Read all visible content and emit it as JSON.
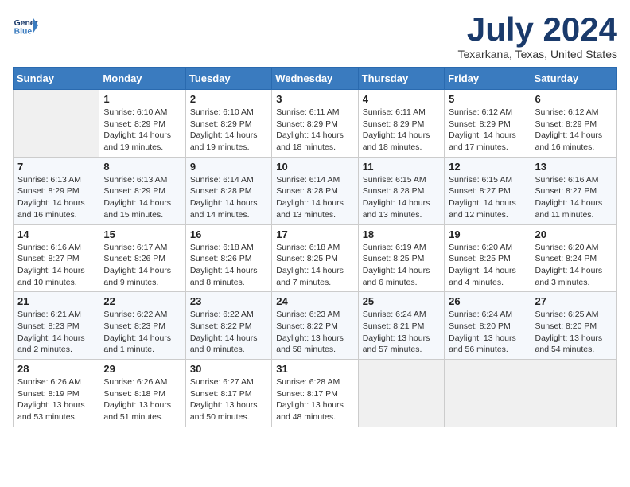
{
  "header": {
    "logo_line1": "General",
    "logo_line2": "Blue",
    "month": "July 2024",
    "location": "Texarkana, Texas, United States"
  },
  "weekdays": [
    "Sunday",
    "Monday",
    "Tuesday",
    "Wednesday",
    "Thursday",
    "Friday",
    "Saturday"
  ],
  "weeks": [
    [
      {
        "day": "",
        "empty": true
      },
      {
        "day": "1",
        "sunrise": "6:10 AM",
        "sunset": "8:29 PM",
        "daylight": "14 hours and 19 minutes."
      },
      {
        "day": "2",
        "sunrise": "6:10 AM",
        "sunset": "8:29 PM",
        "daylight": "14 hours and 19 minutes."
      },
      {
        "day": "3",
        "sunrise": "6:11 AM",
        "sunset": "8:29 PM",
        "daylight": "14 hours and 18 minutes."
      },
      {
        "day": "4",
        "sunrise": "6:11 AM",
        "sunset": "8:29 PM",
        "daylight": "14 hours and 18 minutes."
      },
      {
        "day": "5",
        "sunrise": "6:12 AM",
        "sunset": "8:29 PM",
        "daylight": "14 hours and 17 minutes."
      },
      {
        "day": "6",
        "sunrise": "6:12 AM",
        "sunset": "8:29 PM",
        "daylight": "14 hours and 16 minutes."
      }
    ],
    [
      {
        "day": "7",
        "sunrise": "6:13 AM",
        "sunset": "8:29 PM",
        "daylight": "14 hours and 16 minutes."
      },
      {
        "day": "8",
        "sunrise": "6:13 AM",
        "sunset": "8:29 PM",
        "daylight": "14 hours and 15 minutes."
      },
      {
        "day": "9",
        "sunrise": "6:14 AM",
        "sunset": "8:28 PM",
        "daylight": "14 hours and 14 minutes."
      },
      {
        "day": "10",
        "sunrise": "6:14 AM",
        "sunset": "8:28 PM",
        "daylight": "14 hours and 13 minutes."
      },
      {
        "day": "11",
        "sunrise": "6:15 AM",
        "sunset": "8:28 PM",
        "daylight": "14 hours and 13 minutes."
      },
      {
        "day": "12",
        "sunrise": "6:15 AM",
        "sunset": "8:27 PM",
        "daylight": "14 hours and 12 minutes."
      },
      {
        "day": "13",
        "sunrise": "6:16 AM",
        "sunset": "8:27 PM",
        "daylight": "14 hours and 11 minutes."
      }
    ],
    [
      {
        "day": "14",
        "sunrise": "6:16 AM",
        "sunset": "8:27 PM",
        "daylight": "14 hours and 10 minutes."
      },
      {
        "day": "15",
        "sunrise": "6:17 AM",
        "sunset": "8:26 PM",
        "daylight": "14 hours and 9 minutes."
      },
      {
        "day": "16",
        "sunrise": "6:18 AM",
        "sunset": "8:26 PM",
        "daylight": "14 hours and 8 minutes."
      },
      {
        "day": "17",
        "sunrise": "6:18 AM",
        "sunset": "8:25 PM",
        "daylight": "14 hours and 7 minutes."
      },
      {
        "day": "18",
        "sunrise": "6:19 AM",
        "sunset": "8:25 PM",
        "daylight": "14 hours and 6 minutes."
      },
      {
        "day": "19",
        "sunrise": "6:20 AM",
        "sunset": "8:25 PM",
        "daylight": "14 hours and 4 minutes."
      },
      {
        "day": "20",
        "sunrise": "6:20 AM",
        "sunset": "8:24 PM",
        "daylight": "14 hours and 3 minutes."
      }
    ],
    [
      {
        "day": "21",
        "sunrise": "6:21 AM",
        "sunset": "8:23 PM",
        "daylight": "14 hours and 2 minutes."
      },
      {
        "day": "22",
        "sunrise": "6:22 AM",
        "sunset": "8:23 PM",
        "daylight": "14 hours and 1 minute."
      },
      {
        "day": "23",
        "sunrise": "6:22 AM",
        "sunset": "8:22 PM",
        "daylight": "14 hours and 0 minutes."
      },
      {
        "day": "24",
        "sunrise": "6:23 AM",
        "sunset": "8:22 PM",
        "daylight": "13 hours and 58 minutes."
      },
      {
        "day": "25",
        "sunrise": "6:24 AM",
        "sunset": "8:21 PM",
        "daylight": "13 hours and 57 minutes."
      },
      {
        "day": "26",
        "sunrise": "6:24 AM",
        "sunset": "8:20 PM",
        "daylight": "13 hours and 56 minutes."
      },
      {
        "day": "27",
        "sunrise": "6:25 AM",
        "sunset": "8:20 PM",
        "daylight": "13 hours and 54 minutes."
      }
    ],
    [
      {
        "day": "28",
        "sunrise": "6:26 AM",
        "sunset": "8:19 PM",
        "daylight": "13 hours and 53 minutes."
      },
      {
        "day": "29",
        "sunrise": "6:26 AM",
        "sunset": "8:18 PM",
        "daylight": "13 hours and 51 minutes."
      },
      {
        "day": "30",
        "sunrise": "6:27 AM",
        "sunset": "8:17 PM",
        "daylight": "13 hours and 50 minutes."
      },
      {
        "day": "31",
        "sunrise": "6:28 AM",
        "sunset": "8:17 PM",
        "daylight": "13 hours and 48 minutes."
      },
      {
        "day": "",
        "empty": true
      },
      {
        "day": "",
        "empty": true
      },
      {
        "day": "",
        "empty": true
      }
    ]
  ],
  "labels": {
    "sunrise": "Sunrise:",
    "sunset": "Sunset:",
    "daylight": "Daylight:"
  }
}
